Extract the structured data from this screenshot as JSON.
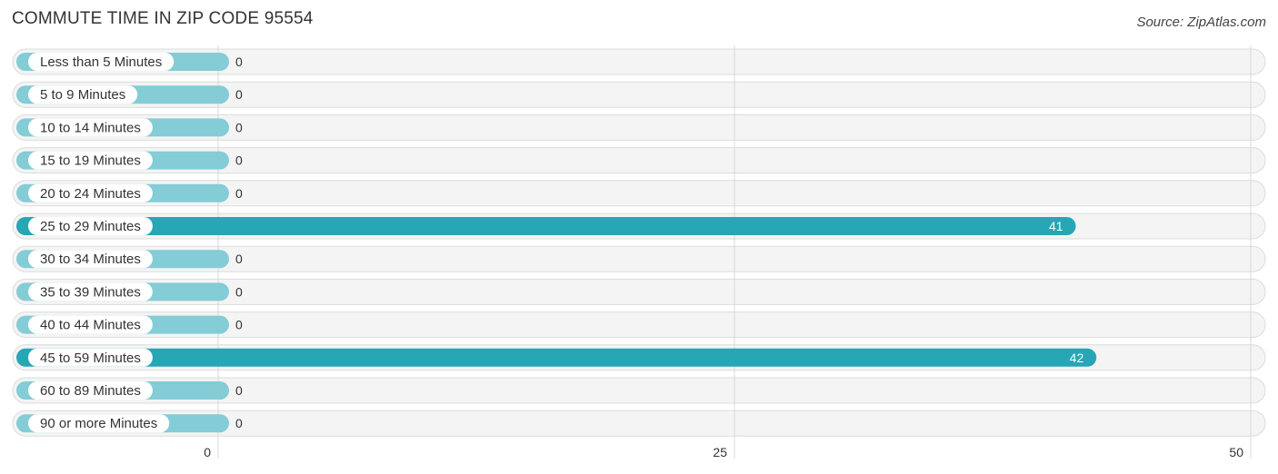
{
  "header": {
    "title": "COMMUTE TIME IN ZIP CODE 95554",
    "source": "Source: ZipAtlas.com"
  },
  "colors": {
    "bar_high": "#27a6b5",
    "bar_low": "#84ccd6",
    "row_background": "#f4f4f4"
  },
  "chart_data": {
    "type": "bar",
    "orientation": "horizontal",
    "title": "COMMUTE TIME IN ZIP CODE 95554",
    "xlabel": "",
    "ylabel": "",
    "xlim": [
      0,
      50
    ],
    "x_ticks": [
      "0",
      "25",
      "50"
    ],
    "grid": true,
    "categories": [
      "Less than 5 Minutes",
      "5 to 9 Minutes",
      "10 to 14 Minutes",
      "15 to 19 Minutes",
      "20 to 24 Minutes",
      "25 to 29 Minutes",
      "30 to 34 Minutes",
      "35 to 39 Minutes",
      "40 to 44 Minutes",
      "45 to 59 Minutes",
      "60 to 89 Minutes",
      "90 or more Minutes"
    ],
    "values": [
      0,
      0,
      0,
      0,
      0,
      41,
      0,
      0,
      0,
      42,
      0,
      0
    ]
  }
}
